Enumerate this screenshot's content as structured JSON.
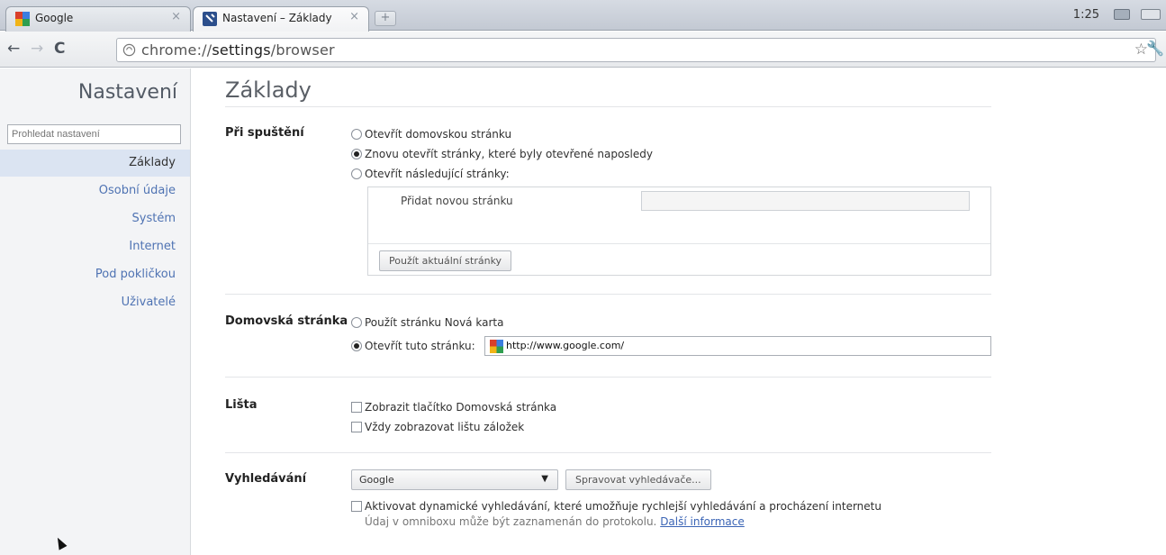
{
  "tabs": [
    {
      "title": "Google",
      "icon": "google-favicon"
    },
    {
      "title": "Nastavení – Základy",
      "icon": "wrench-favicon"
    }
  ],
  "new_tab_label": "+",
  "tab_close_glyph": "×",
  "clock": "1:25",
  "omnibox": {
    "url_prefix": "chrome://",
    "url_host": "settings",
    "url_path": "/browser"
  },
  "sidebar": {
    "title": "Nastavení",
    "search_placeholder": "Prohledat nastavení",
    "items": [
      {
        "label": "Základy",
        "selected": true
      },
      {
        "label": "Osobní údaje",
        "selected": false
      },
      {
        "label": "Systém",
        "selected": false
      },
      {
        "label": "Internet",
        "selected": false
      },
      {
        "label": "Pod pokličkou",
        "selected": false
      },
      {
        "label": "Uživatelé",
        "selected": false
      }
    ]
  },
  "main": {
    "title": "Základy",
    "startup": {
      "heading": "Při spuštění",
      "options": [
        {
          "label": "Otevřít domovskou stránku",
          "checked": false
        },
        {
          "label": "Znovu otevřít stránky, které byly otevřené naposledy",
          "checked": true
        },
        {
          "label": "Otevřít následující stránky:",
          "checked": false
        }
      ],
      "add_page_label": "Přidat novou stránku",
      "use_current_button": "Použít aktuální stránky"
    },
    "homepage": {
      "heading": "Domovská stránka",
      "option_newtab": "Použít stránku Nová karta",
      "option_open": "Otevřít tuto stránku:",
      "url": "http://www.google.com/"
    },
    "toolbar": {
      "heading": "Lišta",
      "show_home_button": "Zobrazit tlačítko Domovská stránka",
      "always_bookmarks": "Vždy zobrazovat lištu záložek"
    },
    "search": {
      "heading": "Vyhledávání",
      "engine": "Google",
      "manage_button": "Spravovat vyhledávače...",
      "instant_label": "Aktivovat dynamické vyhledávání, které umožňuje rychlejší vyhledávání a procházení internetu",
      "note_text": "Údaj v omniboxu může být zaznamenán do protokolu.",
      "note_link": "Další informace"
    }
  },
  "colors": {
    "link": "#4f73b3",
    "selected_nav": "#dbe4f2"
  }
}
